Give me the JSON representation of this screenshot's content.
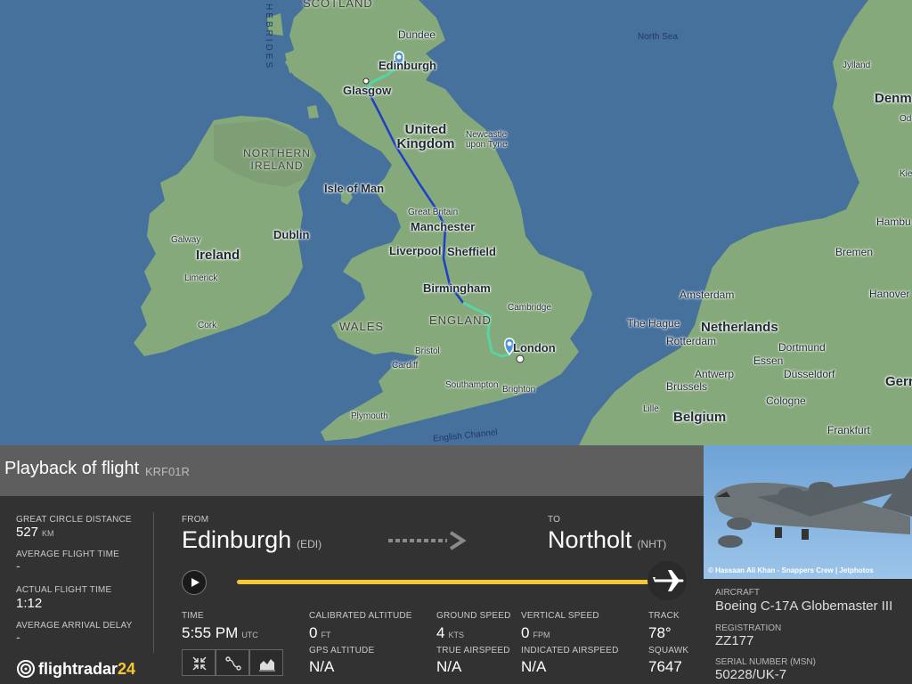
{
  "map": {
    "labels": {
      "scotland": "SCOTLAND",
      "hebrides": "HEBRIDES",
      "dundee": "Dundee",
      "edinburgh": "Edinburgh",
      "glasgow": "Glasgow",
      "north_sea": "North Sea",
      "jylland": "Jylland",
      "denmark": "Denm",
      "od": "Od",
      "united_kingdom": "United Kingdom",
      "newcastle": "Newcastle upon Tyne",
      "northern_ireland": "NORTHERN IRELAND",
      "isle_of_man": "Isle of Man",
      "great_britain": "Great Britain",
      "manchester": "Manchester",
      "dublin": "Dublin",
      "liverpool": "Liverpool",
      "sheffield": "Sheffield",
      "ireland": "Ireland",
      "galway": "Galway",
      "limerick": "Limerick",
      "cork": "Cork",
      "birmingham": "Birmingham",
      "england": "ENGLAND",
      "cambridge": "Cambridge",
      "wales": "WALES",
      "london": "London",
      "bristol": "Bristol",
      "cardiff": "Cardiff",
      "southampton": "Southampton",
      "brighton": "Brighton",
      "plymouth": "Plymouth",
      "english_channel": "English Channel",
      "amsterdam": "Amsterdam",
      "the_hague": "The Hague",
      "netherlands": "Netherlands",
      "rotterdam": "Rotterdam",
      "antwerp": "Antwerp",
      "brussels": "Brussels",
      "belgium": "Belgium",
      "lille": "Lille",
      "dortmund": "Dortmund",
      "essen": "Essen",
      "dusseldorf": "Düsseldorf",
      "cologne": "Cologne",
      "frankfurt": "Frankfurt",
      "bremen": "Bremen",
      "hamburg": "Hambu",
      "hanover": "Hanover",
      "germany": "Gerr",
      "kie": "Kie"
    }
  },
  "flight": {
    "title": "Playback of flight",
    "code": "KRF01R",
    "great_circle_distance_label": "GREAT CIRCLE DISTANCE",
    "great_circle_distance_value": "527",
    "great_circle_distance_unit": "KM",
    "average_flight_time_label": "AVERAGE FLIGHT TIME",
    "average_flight_time_value": "-",
    "actual_flight_time_label": "ACTUAL FLIGHT TIME",
    "actual_flight_time_value": "1:12",
    "average_arrival_delay_label": "AVERAGE ARRIVAL DELAY",
    "average_arrival_delay_value": "-",
    "from_label": "FROM",
    "from_city": "Edinburgh",
    "from_code": "(EDI)",
    "to_label": "TO",
    "to_city": "Northolt",
    "to_code": "(NHT)",
    "progress": 1.0
  },
  "stats": {
    "time_label": "TIME",
    "time_value": "5:55 PM",
    "time_unit": "UTC",
    "calibrated_altitude_label": "CALIBRATED ALTITUDE",
    "calibrated_altitude_value": "0",
    "calibrated_altitude_unit": "FT",
    "gps_altitude_label": "GPS ALTITUDE",
    "gps_altitude_value": "N/A",
    "ground_speed_label": "GROUND SPEED",
    "ground_speed_value": "4",
    "ground_speed_unit": "KTS",
    "true_airspeed_label": "TRUE AIRSPEED",
    "true_airspeed_value": "N/A",
    "vertical_speed_label": "VERTICAL SPEED",
    "vertical_speed_value": "0",
    "vertical_speed_unit": "FPM",
    "indicated_airspeed_label": "INDICATED AIRSPEED",
    "indicated_airspeed_value": "N/A",
    "track_label": "TRACK",
    "track_value": "78°",
    "squawk_label": "SQUAWK",
    "squawk_value": "7647"
  },
  "aircraft": {
    "photo_credit": "© Hassaan Ali Khan - Snappers Crew | Jetphotos",
    "aircraft_label": "AIRCRAFT",
    "aircraft_value": "Boeing C-17A Globemaster III",
    "registration_label": "REGISTRATION",
    "registration_value": "ZZ177",
    "serial_label": "SERIAL NUMBER (MSN)",
    "serial_value": "50228/UK-7"
  },
  "logo": {
    "text": "flightradar",
    "num": "24"
  },
  "colors": {
    "progress": "#f7c72f",
    "route_main": "#1f3fc8",
    "route_green": "#58d3a4",
    "sea": "#47719d",
    "land": "#84a87a"
  }
}
